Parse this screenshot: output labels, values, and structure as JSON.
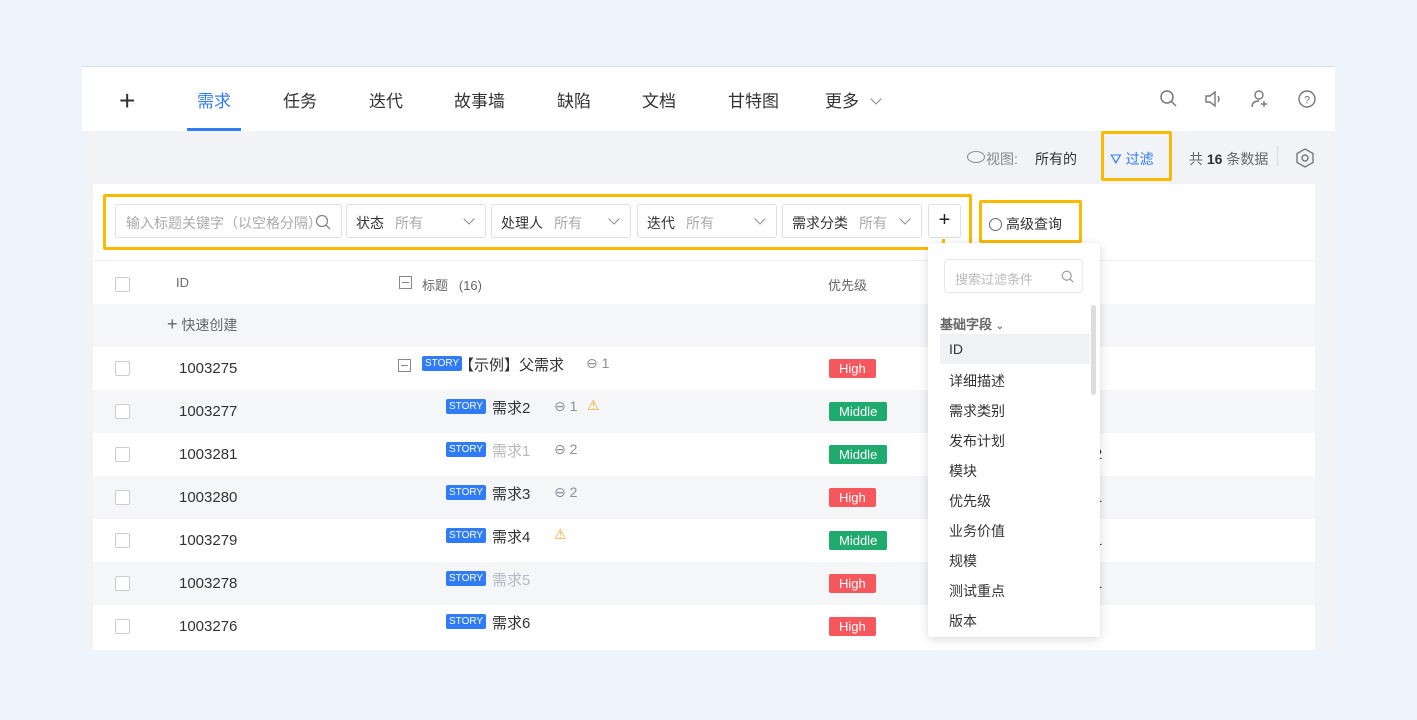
{
  "nav": {
    "add_icon": "plus-icon",
    "tabs": [
      "需求",
      "任务",
      "迭代",
      "故事墙",
      "缺陷",
      "文档",
      "甘特图",
      "更多"
    ],
    "active": 0,
    "icons": [
      "search-icon",
      "speaker-icon",
      "user-add-icon",
      "help-icon"
    ]
  },
  "toolbar": {
    "view_label": "视图:",
    "view_value": "所有的",
    "filter_label": "过滤",
    "count_prefix": "共",
    "count": "16",
    "count_suffix": "条数据"
  },
  "filters": {
    "search_placeholder": "输入标题关键字（以空格分隔）",
    "fields": [
      {
        "label": "状态",
        "value": "所有"
      },
      {
        "label": "处理人",
        "value": "所有"
      },
      {
        "label": "迭代",
        "value": "所有"
      },
      {
        "label": "需求分类",
        "value": "所有"
      }
    ],
    "add": "+",
    "advanced": "高级查询"
  },
  "table": {
    "headers": {
      "id": "ID",
      "title": "标题",
      "title_count": "(16)",
      "priority": "优先级"
    },
    "quick_create": "快速创建",
    "rows": [
      {
        "id": "1003275",
        "title": "【示例】父需求",
        "links": "1",
        "warn": false,
        "dim": false,
        "priority": "High",
        "extra": ""
      },
      {
        "id": "1003277",
        "title": "需求2",
        "links": "1",
        "warn": true,
        "dim": false,
        "priority": "Middle",
        "extra": ""
      },
      {
        "id": "1003281",
        "title": "需求1",
        "links": "2",
        "warn": false,
        "dim": true,
        "priority": "Middle",
        "extra": "C2"
      },
      {
        "id": "1003280",
        "title": "需求3",
        "links": "2",
        "warn": false,
        "dim": false,
        "priority": "High",
        "extra": "C1"
      },
      {
        "id": "1003279",
        "title": "需求4",
        "links": "",
        "warn": true,
        "dim": false,
        "priority": "Middle",
        "extra": "C1"
      },
      {
        "id": "1003278",
        "title": "需求5",
        "links": "",
        "warn": false,
        "dim": true,
        "priority": "High",
        "extra": "C1"
      },
      {
        "id": "1003276",
        "title": "需求6",
        "links": "",
        "warn": false,
        "dim": false,
        "priority": "High",
        "extra": ""
      }
    ],
    "story_tag": "STORY"
  },
  "colors": {
    "accent": "#2f7cf6",
    "high": "#f5575c",
    "middle": "#1faa6e",
    "highlight": "#fbb900"
  },
  "dropdown": {
    "search_placeholder": "搜索过滤条件",
    "group": "基础字段",
    "items": [
      "ID",
      "详细描述",
      "需求类别",
      "发布计划",
      "模块",
      "优先级",
      "业务价值",
      "规模",
      "测试重点",
      "版本"
    ]
  }
}
